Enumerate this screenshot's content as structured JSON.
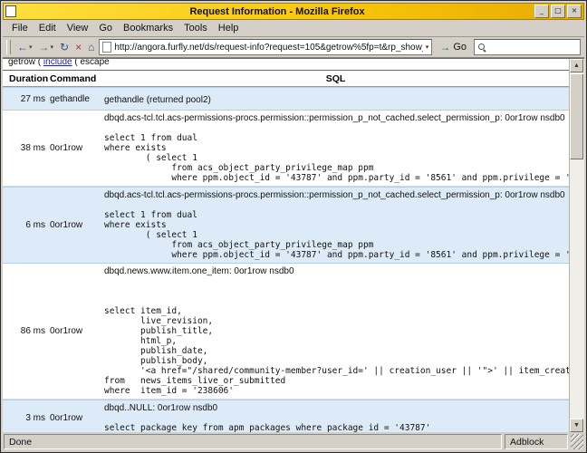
{
  "window": {
    "title": "Request Information - Mozilla Firefox"
  },
  "icons": {
    "minimize": "_",
    "maximize": "□",
    "close": "×",
    "back": "←",
    "forward": "→",
    "reload": "↻",
    "stop": "×",
    "home": "⌂",
    "go_arrow": "→",
    "dropdown": "▾",
    "scroll_up": "▲",
    "scroll_down": "▼"
  },
  "menubar": {
    "items": [
      "File",
      "Edit",
      "View",
      "Go",
      "Bookmarks",
      "Tools",
      "Help"
    ]
  },
  "toolbar": {
    "url": "http://angora.furfly.net/ds/request-info?request=105&getrow%5fp=t&rp_show_debug_p",
    "go_label": "Go"
  },
  "page": {
    "partial_line": {
      "prefix": "getrow ( ",
      "link": "include",
      "suffix": " ( escape"
    },
    "table": {
      "headers": [
        "Duration",
        "Command",
        "SQL"
      ],
      "rows": [
        {
          "duration": "27 ms",
          "command": "gethandle",
          "sql_header": "gethandle (returned pool2)",
          "sql_body": ""
        },
        {
          "duration": "38 ms",
          "command": "0or1row",
          "sql_header": "dbqd.acs-tcl.tcl.acs-permissions-procs.permission::permission_p_not_cached.select_permission_p: 0or1row nsdb0",
          "sql_body": "select 1 from dual\nwhere exists\n        ( select 1\n             from acs_object_party_privilege_map ppm\n             where ppm.object_id = '43787' and ppm.party_id = '8561' and ppm.privilege = 'read' )"
        },
        {
          "duration": "6 ms",
          "command": "0or1row",
          "sql_header": "dbqd.acs-tcl.tcl.acs-permissions-procs.permission::permission_p_not_cached.select_permission_p: 0or1row nsdb0",
          "sql_body": "select 1 from dual\nwhere exists\n        ( select 1\n             from acs_object_party_privilege_map ppm\n             where ppm.object_id = '43787' and ppm.party_id = '8561' and ppm.privilege = 'news_read' )"
        },
        {
          "duration": "86 ms",
          "command": "0or1row",
          "sql_header": "dbqd.news.www.item.one_item: 0or1row nsdb0",
          "sql_body": "\n\nselect item_id,\n       live_revision,\n       publish_title,\n       html_p,\n       publish_date,\n       publish_body,\n       '<a href=\"/shared/community-member?user_id=' || creation_user || '\">' || item_creator || '</a>'\nfrom   news_items_live_or_submitted\nwhere  item_id = '238606'"
        },
        {
          "duration": "3 ms",
          "command": "0or1row",
          "sql_header": "dbqd..NULL: 0or1row nsdb0",
          "sql_body": "select package_key from apm_packages where package_id = '43787'"
        }
      ]
    }
  },
  "statusbar": {
    "status": "Done",
    "adblock": "Adblock"
  }
}
